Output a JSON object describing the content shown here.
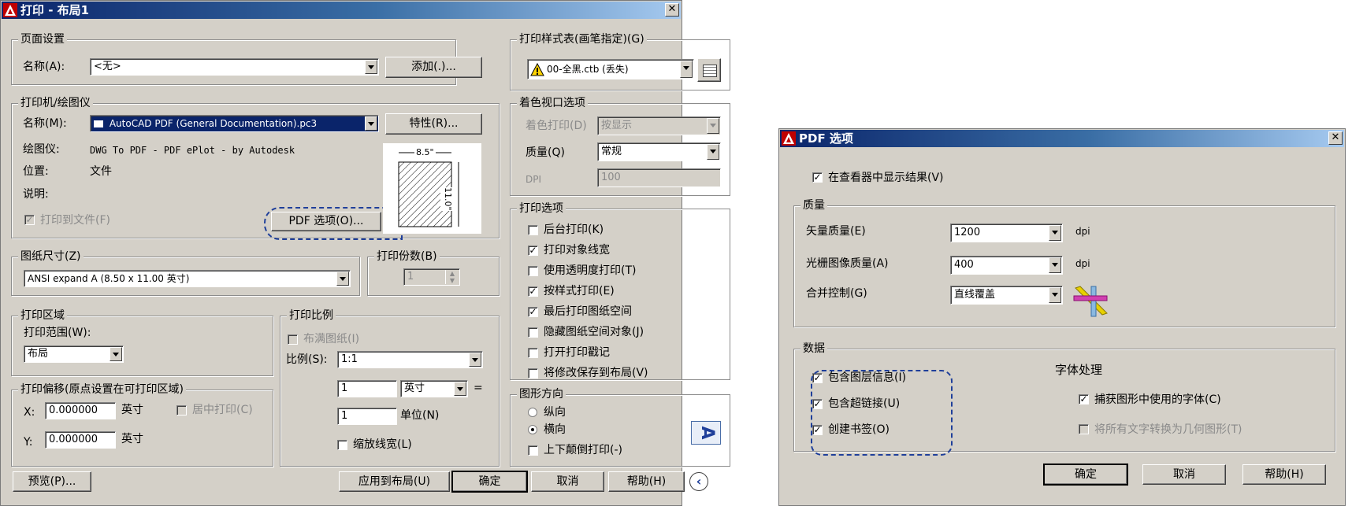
{
  "print_dialog": {
    "title": "打印 - 布局1",
    "page_setup": {
      "legend": "页面设置",
      "name_label": "名称(A):",
      "name_value": "<无>",
      "add_button": "添加(.)..."
    },
    "printer": {
      "legend": "打印机/绘图仪",
      "name_label": "名称(M):",
      "name_value": "AutoCAD PDF (General Documentation).pc3",
      "properties_button": "特性(R)...",
      "plotter_label": "绘图仪:",
      "plotter_value": "DWG To PDF - PDF ePlot - by Autodesk",
      "location_label": "位置:",
      "location_value": "文件",
      "description_label": "说明:",
      "print_to_file": "打印到文件(F)",
      "pdf_options_button": "PDF 选项(O)...",
      "paper_width_label": "8.5\"",
      "paper_height_label": "11.0\""
    },
    "paper_size": {
      "legend": "图纸尺寸(Z)",
      "value": "ANSI expand A (8.50 x 11.00 英寸)"
    },
    "copies": {
      "legend": "打印份数(B)",
      "value": "1"
    },
    "plot_area": {
      "legend": "打印区域",
      "range_label": "打印范围(W):",
      "range_value": "布局"
    },
    "plot_offset": {
      "legend": "打印偏移(原点设置在可打印区域)",
      "x_label": "X:",
      "x_value": "0.000000",
      "x_unit": "英寸",
      "y_label": "Y:",
      "y_value": "0.000000",
      "y_unit": "英寸",
      "center": "居中打印(C)"
    },
    "plot_scale": {
      "legend": "打印比例",
      "fit_paper": "布满图纸(I)",
      "scale_label": "比例(S):",
      "scale_value": "1:1",
      "num_value": "1",
      "unit_value": "英寸",
      "equals": "=",
      "den_value": "1",
      "unit_label": "单位(N)",
      "scale_lineweights": "缩放线宽(L)"
    },
    "style_table": {
      "legend": "打印样式表(画笔指定)(G)",
      "value": "00-全黑.ctb (丢失)"
    },
    "shaded_viewport": {
      "legend": "着色视口选项",
      "shade_label": "着色打印(D)",
      "shade_value": "按显示",
      "quality_label": "质量(Q)",
      "quality_value": "常规",
      "dpi_label": "DPI",
      "dpi_value": "100"
    },
    "plot_options": {
      "legend": "打印选项",
      "items": [
        {
          "label": "后台打印(K)",
          "checked": false
        },
        {
          "label": "打印对象线宽",
          "checked": true
        },
        {
          "label": "使用透明度打印(T)",
          "checked": false
        },
        {
          "label": "按样式打印(E)",
          "checked": true
        },
        {
          "label": "最后打印图纸空间",
          "checked": true
        },
        {
          "label": "隐藏图纸空间对象(J)",
          "checked": false
        },
        {
          "label": "打开打印戳记",
          "checked": false
        },
        {
          "label": "将修改保存到布局(V)",
          "checked": false
        }
      ]
    },
    "orientation": {
      "legend": "图形方向",
      "portrait": "纵向",
      "landscape": "横向",
      "upside_down": "上下颠倒打印(-)"
    },
    "buttons": {
      "preview": "预览(P)...",
      "apply": "应用到布局(U)",
      "ok": "确定",
      "cancel": "取消",
      "help": "帮助(H)"
    }
  },
  "pdf_dialog": {
    "title": "PDF 选项",
    "show_viewer": "在查看器中显示结果(V)",
    "quality": {
      "legend": "质量",
      "vector_label": "矢量质量(E)",
      "vector_value": "1200",
      "vector_unit": "dpi",
      "raster_label": "光栅图像质量(A)",
      "raster_value": "400",
      "raster_unit": "dpi",
      "merge_label": "合并控制(G)",
      "merge_value": "直线覆盖"
    },
    "data": {
      "legend": "数据",
      "layer_info": "包含图层信息(I)",
      "hyperlinks": "包含超链接(U)",
      "bookmarks": "创建书签(O)"
    },
    "fonts": {
      "heading": "字体处理",
      "capture_fonts": "捕获图形中使用的字体(C)",
      "convert_text": "将所有文字转换为几何图形(T)"
    },
    "buttons": {
      "ok": "确定",
      "cancel": "取消",
      "help": "帮助(H)"
    }
  }
}
